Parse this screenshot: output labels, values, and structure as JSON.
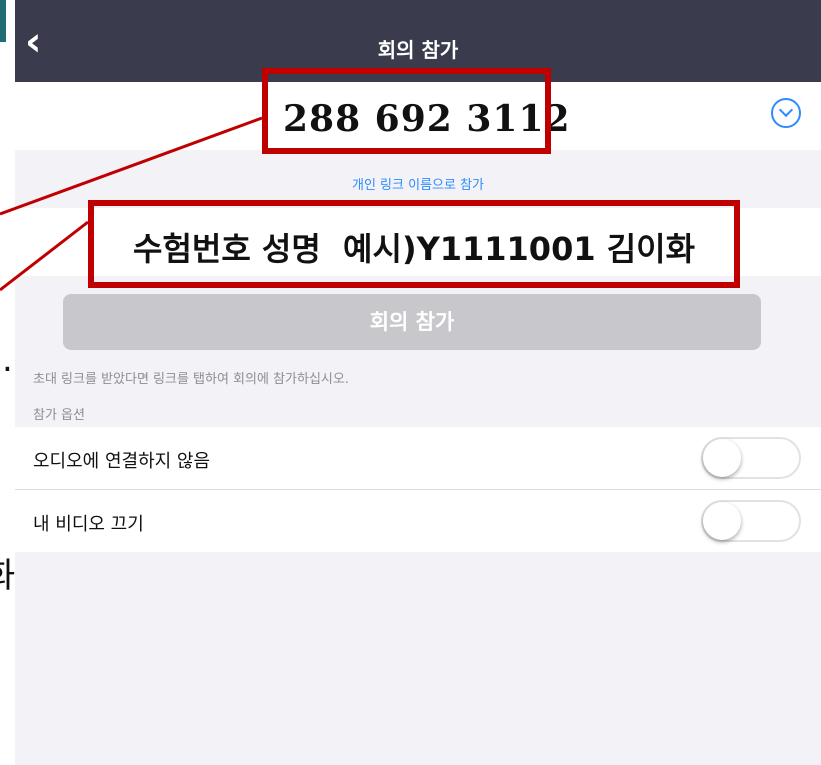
{
  "nav": {
    "back_icon": "chevron-left-icon",
    "title": "회의 참가"
  },
  "meeting": {
    "id": "288  692 3112",
    "dropdown_icon": "chevron-down-circle-icon"
  },
  "personal_link": "개인 링크 이름으로 참가",
  "name_field": {
    "value": "수험번호 성명  예시)Y1111001 김이화"
  },
  "join_button": "회의 참가",
  "invite_note": "초대 링크를 받았다면 링크를 탭하여 회의에 참가하십시오.",
  "options": {
    "header": "참가 옵션",
    "items": [
      {
        "label": "오디오에 연결하지 않음",
        "on": false
      },
      {
        "label": "내 비디오 끄기",
        "on": false
      }
    ]
  },
  "left_fragments": [
    ".",
    "화"
  ],
  "colors": {
    "nav_bg": "#3a3c4e",
    "accent": "#2d8cff",
    "annotation": "#c00000",
    "button_disabled": "#c8c8cc"
  }
}
